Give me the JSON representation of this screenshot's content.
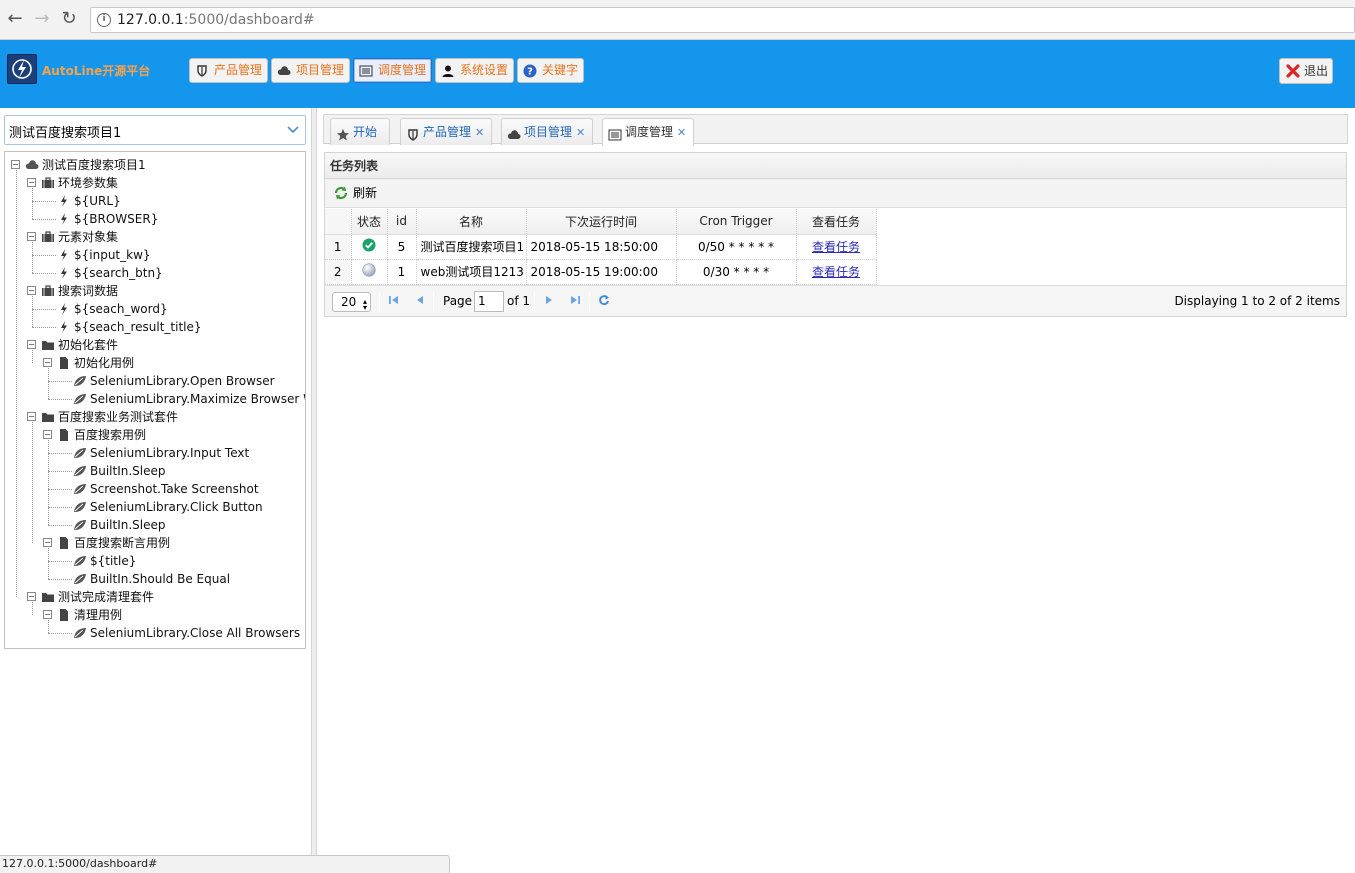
{
  "browser": {
    "url_host": "127.0.0.1",
    "url_path": ":5000/dashboard#",
    "status_url": "127.0.0.1:5000/dashboard#"
  },
  "header": {
    "app_name": "AutoLine开源平台",
    "menu": [
      {
        "label": "产品管理",
        "icon": "shield-icon"
      },
      {
        "label": "项目管理",
        "icon": "cloud-icon"
      },
      {
        "label": "调度管理",
        "icon": "list-icon"
      },
      {
        "label": "系统设置",
        "icon": "user-icon"
      },
      {
        "label": "关键字",
        "icon": "help-icon"
      }
    ],
    "logout_label": "退出"
  },
  "sidebar": {
    "project_select": "测试百度搜索项目1",
    "tree": [
      {
        "label": "测试百度搜索项目1",
        "icon": "cloud-icon",
        "level": 0
      },
      {
        "label": "环境参数集",
        "icon": "suitcase-icon",
        "level": 1
      },
      {
        "label": "${URL}",
        "icon": "bolt-icon",
        "level": 2
      },
      {
        "label": "${BROWSER}",
        "icon": "bolt-icon",
        "level": 2
      },
      {
        "label": "元素对象集",
        "icon": "suitcase-icon",
        "level": 1
      },
      {
        "label": "${input_kw}",
        "icon": "bolt-icon",
        "level": 2
      },
      {
        "label": "${search_btn}",
        "icon": "bolt-icon",
        "level": 2
      },
      {
        "label": "搜索词数据",
        "icon": "suitcase-icon",
        "level": 1
      },
      {
        "label": "${seach_word}",
        "icon": "bolt-icon",
        "level": 2
      },
      {
        "label": "${seach_result_title}",
        "icon": "bolt-icon",
        "level": 2
      },
      {
        "label": "初始化套件",
        "icon": "folder-icon",
        "level": 1
      },
      {
        "label": "初始化用例",
        "icon": "file-icon",
        "level": 2
      },
      {
        "label": "SeleniumLibrary.Open Browser",
        "icon": "leaf-icon",
        "level": 3
      },
      {
        "label": "SeleniumLibrary.Maximize Browser Window",
        "icon": "leaf-icon",
        "level": 3
      },
      {
        "label": "百度搜索业务测试套件",
        "icon": "folder-icon",
        "level": 1
      },
      {
        "label": "百度搜索用例",
        "icon": "file-icon",
        "level": 2
      },
      {
        "label": "SeleniumLibrary.Input Text",
        "icon": "leaf-icon",
        "level": 3
      },
      {
        "label": "BuiltIn.Sleep",
        "icon": "leaf-icon",
        "level": 3
      },
      {
        "label": "Screenshot.Take Screenshot",
        "icon": "leaf-icon",
        "level": 3
      },
      {
        "label": "SeleniumLibrary.Click Button",
        "icon": "leaf-icon",
        "level": 3
      },
      {
        "label": "BuiltIn.Sleep",
        "icon": "leaf-icon",
        "level": 3
      },
      {
        "label": "百度搜索断言用例",
        "icon": "file-icon",
        "level": 2
      },
      {
        "label": "${title}",
        "icon": "leaf-icon",
        "level": 3
      },
      {
        "label": "BuiltIn.Should Be Equal",
        "icon": "leaf-icon",
        "level": 3
      },
      {
        "label": "测试完成清理套件",
        "icon": "folder-icon",
        "level": 1
      },
      {
        "label": "清理用例",
        "icon": "file-icon",
        "level": 2
      },
      {
        "label": "SeleniumLibrary.Close All Browsers",
        "icon": "leaf-icon",
        "level": 3
      }
    ]
  },
  "tabs": [
    {
      "label": "开始",
      "icon": "star-icon",
      "closable": false
    },
    {
      "label": "产品管理",
      "icon": "shield-icon",
      "closable": true
    },
    {
      "label": "项目管理",
      "icon": "cloud-icon",
      "closable": true
    },
    {
      "label": "调度管理",
      "icon": "list-icon",
      "closable": true,
      "active": true
    }
  ],
  "task_panel": {
    "title": "任务列表",
    "refresh_label": "刷新",
    "columns": [
      "状态",
      "id",
      "名称",
      "下次运行时间",
      "Cron Trigger",
      "查看任务"
    ],
    "rows": [
      {
        "num": "1",
        "status": "ok-icon",
        "id": "5",
        "name": "测试百度搜索项目1",
        "next_run": "2018-05-15 18:50:00",
        "cron": "0/50 * * * * *",
        "view": "查看任务"
      },
      {
        "num": "2",
        "status": "idle-icon",
        "id": "1",
        "name": "web测试项目1213",
        "next_run": "2018-05-15 19:00:00",
        "cron": "0/30 * * * *",
        "view": "查看任务"
      }
    ],
    "pager": {
      "page_size": "20",
      "page_label": "Page",
      "page_value": "1",
      "of_label": "of 1",
      "display_text": "Displaying 1 to 2 of 2 items"
    }
  },
  "colors": {
    "header_bg": "#1496ed",
    "menu_text": "#e8731c",
    "tab_text": "#1f67b6"
  }
}
